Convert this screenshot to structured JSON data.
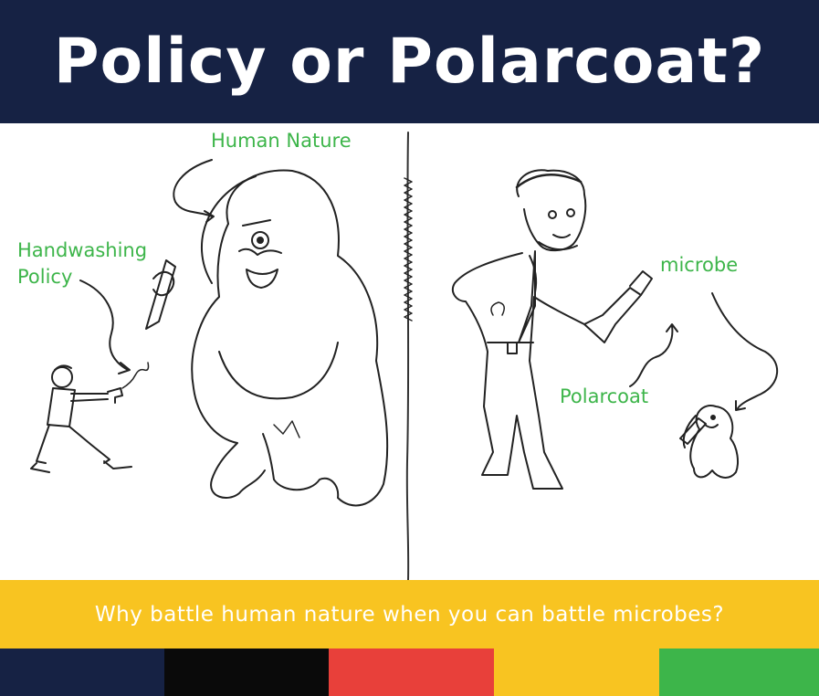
{
  "header": {
    "title": "Policy or Polarcoat?"
  },
  "labels": {
    "human_nature": "Human Nature",
    "handwashing_policy": "Handwashing\nPolicy",
    "microbe": "microbe",
    "polarcoat": "Polarcoat"
  },
  "tagline": "Why battle human nature when you can battle microbes?",
  "colors": {
    "header_bg": "#162244",
    "label_green": "#3db54a",
    "banner_yellow": "#f8c421",
    "stripes": [
      "#162244",
      "#0a0a0a",
      "#e8403a",
      "#f8c421",
      "#3db54a"
    ]
  },
  "illustrations": [
    "man-with-water-pistol-icon",
    "human-nature-monster-icon",
    "man-with-paintbrush-icon",
    "small-microbe-monster-icon"
  ]
}
